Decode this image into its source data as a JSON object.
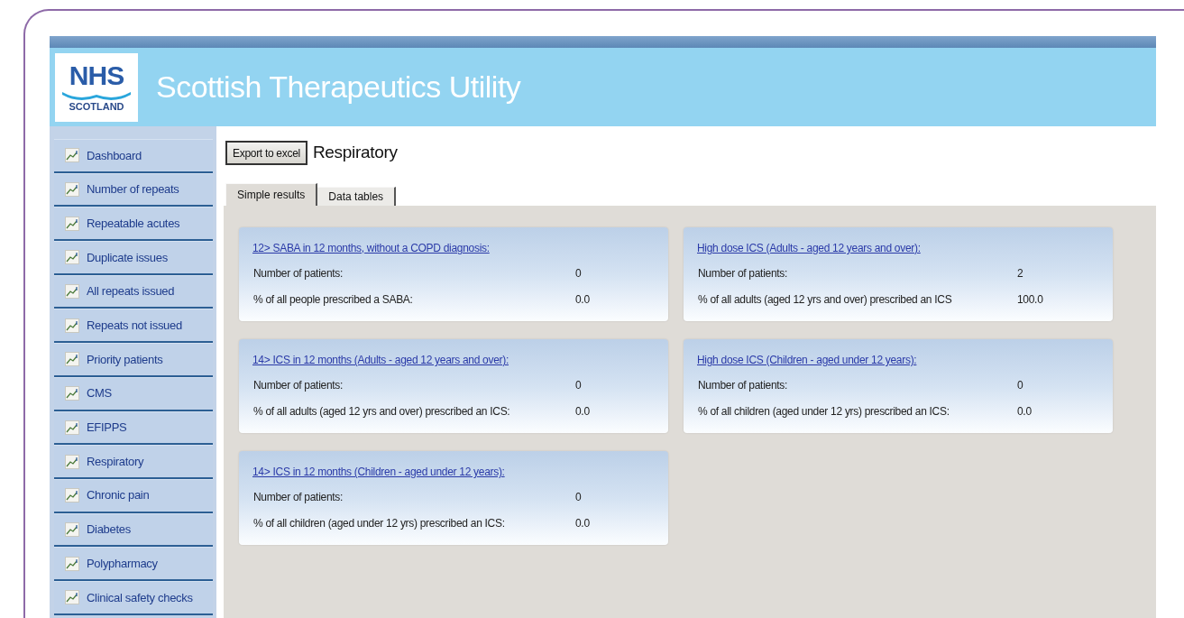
{
  "app": {
    "logo_top": "NHS",
    "logo_bottom": "SCOTLAND",
    "title": "Scottish Therapeutics Utility"
  },
  "sidebar": {
    "items": [
      {
        "label": "Dashboard"
      },
      {
        "label": "Number of repeats"
      },
      {
        "label": "Repeatable acutes"
      },
      {
        "label": "Duplicate issues"
      },
      {
        "label": "All repeats issued"
      },
      {
        "label": "Repeats not issued"
      },
      {
        "label": "Priority patients"
      },
      {
        "label": "CMS"
      },
      {
        "label": "EFIPPS"
      },
      {
        "label": "Respiratory"
      },
      {
        "label": "Chronic pain"
      },
      {
        "label": "Diabetes"
      },
      {
        "label": "Polypharmacy"
      },
      {
        "label": "Clinical safety checks"
      }
    ]
  },
  "toolbar": {
    "export_button": "Export to excel",
    "page_title": "Respiratory"
  },
  "tabs": [
    {
      "label": "Simple results",
      "selected": true
    },
    {
      "label": "Data tables",
      "selected": false
    }
  ],
  "cards": [
    {
      "title": "12> SABA in 12 months, without a COPD diagnosis:",
      "rows": [
        {
          "label": "Number of patients:",
          "value": "0"
        },
        {
          "label": "% of all people prescribed a SABA:",
          "value": "0.0"
        }
      ]
    },
    {
      "title": "High dose ICS (Adults - aged 12 years and over):",
      "rows": [
        {
          "label": "Number of patients:",
          "value": "2"
        },
        {
          "label": "% of all adults (aged 12 yrs and over) prescribed an ICS",
          "value": "100.0"
        }
      ]
    },
    {
      "title": "14> ICS in 12 months (Adults - aged 12 years and over):",
      "rows": [
        {
          "label": "Number of patients:",
          "value": "0"
        },
        {
          "label": "% of all adults (aged 12 yrs and over) prescribed an ICS:",
          "value": "0.0"
        }
      ]
    },
    {
      "title": "High dose ICS (Children - aged under 12 years):",
      "rows": [
        {
          "label": "Number of patients:",
          "value": "0"
        },
        {
          "label": "% of all children (aged under 12 yrs) prescribed an ICS:",
          "value": "0.0"
        }
      ]
    },
    {
      "title": "14> ICS in 12 months (Children - aged under 12 years):",
      "rows": [
        {
          "label": "Number of patients:",
          "value": "0"
        },
        {
          "label": "% of all children (aged under 12 yrs) prescribed an ICS:",
          "value": "0.0"
        }
      ]
    }
  ]
}
